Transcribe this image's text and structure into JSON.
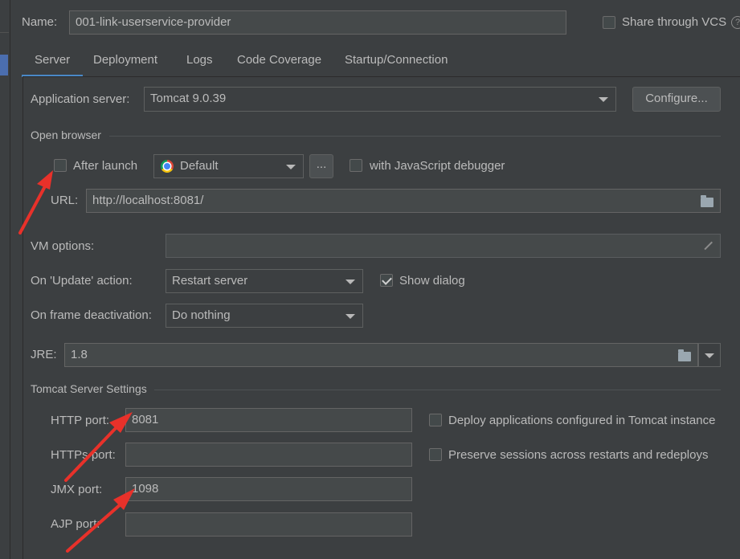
{
  "header": {
    "name_label": "Name:",
    "name_value": "001-link-userservice-provider",
    "share_label": "Share through VCS",
    "help": "?"
  },
  "tabs": [
    {
      "label": "Server",
      "active": true
    },
    {
      "label": "Deployment",
      "active": false
    },
    {
      "label": "Logs",
      "active": false
    },
    {
      "label": "Code Coverage",
      "active": false
    },
    {
      "label": "Startup/Connection",
      "active": false
    }
  ],
  "app_server": {
    "label": "Application server:",
    "value": "Tomcat 9.0.39",
    "configure_label": "Configure..."
  },
  "open_browser": {
    "title": "Open browser",
    "after_launch_label": "After launch",
    "after_launch_checked": false,
    "browser_value": "Default",
    "ellipsis": "...",
    "js_debugger_label": "with JavaScript debugger",
    "js_debugger_checked": false,
    "url_label": "URL:",
    "url_value": "http://localhost:8081/"
  },
  "vm_options": {
    "label": "VM options:",
    "value": ""
  },
  "on_update": {
    "label": "On 'Update' action:",
    "value": "Restart server",
    "show_dialog_label": "Show dialog",
    "show_dialog_checked": true
  },
  "on_frame": {
    "label": "On frame deactivation:",
    "value": "Do nothing"
  },
  "jre": {
    "label": "JRE:",
    "value": "1.8"
  },
  "tomcat": {
    "title": "Tomcat Server Settings",
    "http_label": "HTTP port:",
    "http_value": "8081",
    "https_label": "HTTPs port:",
    "https_value": "",
    "jmx_label": "JMX port:",
    "jmx_value": "1098",
    "ajp_label": "AJP port:",
    "ajp_value": "",
    "deploy_label": "Deploy applications configured in Tomcat instance",
    "deploy_checked": false,
    "preserve_label": "Preserve sessions across restarts and redeploys",
    "preserve_checked": false
  },
  "colors": {
    "background": "#3c3f41",
    "field": "#45494a",
    "accent": "#4a88c7",
    "annotation": "#e8312a"
  },
  "icons": [
    "chrome-icon",
    "folder-icon",
    "expand-icon",
    "dropdown-arrow-icon",
    "help-icon",
    "red-arrow-annotation"
  ]
}
